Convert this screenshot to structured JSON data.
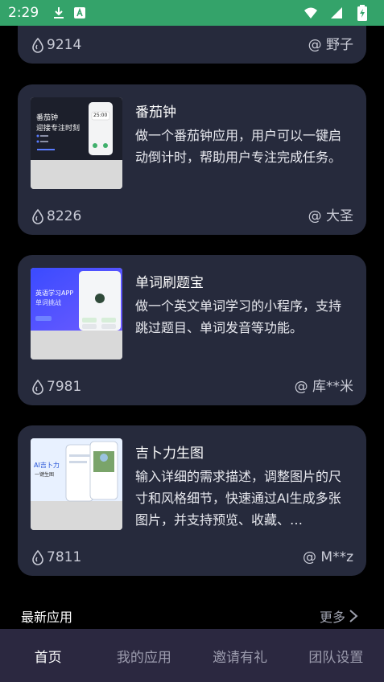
{
  "status_bar": {
    "time": "2:29",
    "icons": [
      "download-icon",
      "a-app-icon",
      "wifi-icon",
      "signal-icon",
      "battery-charging-icon"
    ]
  },
  "cards": [
    {
      "views": "9214",
      "author": "@ 野子"
    },
    {
      "title": "番茄钟",
      "desc": "做一个番茄钟应用，用户可以一键启动倒计时，帮助用户专注完成任务。",
      "views": "8226",
      "author": "@ 大圣",
      "thumb": {
        "heading1": "番茄钟",
        "heading2": "迎接专注时刻",
        "timer": "25:00"
      }
    },
    {
      "title": "单词刷题宝",
      "desc": "做一个英文单词学习的小程序，支持跳过题目、单词发音等功能。",
      "views": "7981",
      "author": "@ 库**米",
      "thumb": {
        "heading1": "英语学习APP",
        "heading2": "单词挑战"
      }
    },
    {
      "title": "吉卜力生图",
      "desc": "输入详细的需求描述，调整图片的尺寸和风格细节，快速通过AI生成多张图片，并支持预览、收藏、…",
      "views": "7811",
      "author": "@ M**z",
      "thumb": {
        "heading1": "AI吉卜力",
        "heading2": "一键生图"
      }
    }
  ],
  "section": {
    "title": "最新应用",
    "more": "更多"
  },
  "tabs": [
    "首页",
    "我的应用",
    "邀请有礼",
    "团队设置"
  ],
  "colors": {
    "status_bar": "#34a36a",
    "card": "#262a3c",
    "tabbar": "#2b2840"
  }
}
